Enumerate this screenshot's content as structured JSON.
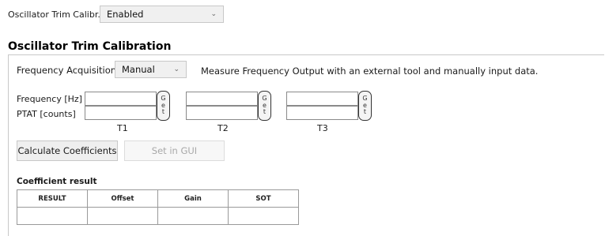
{
  "top": {
    "label": "Oscillator Trim Calibr.",
    "select_value": "Enabled"
  },
  "group": {
    "title": "Oscillator Trim Calibration",
    "freq_acq_label": "Frequency Acquisition",
    "freq_acq_value": "Manual",
    "freq_acq_desc": "Measure Frequency Output with an external tool and manually input data."
  },
  "inputs": {
    "frequency_label": "Frequency [Hz]",
    "ptat_label": "PTAT [counts]",
    "get_glyphs": [
      "G",
      "e",
      "t"
    ],
    "columns": [
      {
        "label": "T1",
        "frequency_value": "",
        "ptat_value": ""
      },
      {
        "label": "T2",
        "frequency_value": "",
        "ptat_value": ""
      },
      {
        "label": "T3",
        "frequency_value": "",
        "ptat_value": ""
      }
    ]
  },
  "actions": {
    "calculate_label": "Calculate Coefficients",
    "set_in_gui_label": "Set in GUI"
  },
  "results": {
    "title": "Coefficient result",
    "headers": [
      "RESULT",
      "Offset",
      "Gain",
      "SOT"
    ],
    "row": [
      "",
      "",
      "",
      ""
    ]
  },
  "colors": {
    "border": "#c8c8c8",
    "field_border": "#8a8a8a",
    "disabled_text": "#a8a8a8"
  },
  "icons": {
    "dropdown": "chevron-down-icon"
  }
}
